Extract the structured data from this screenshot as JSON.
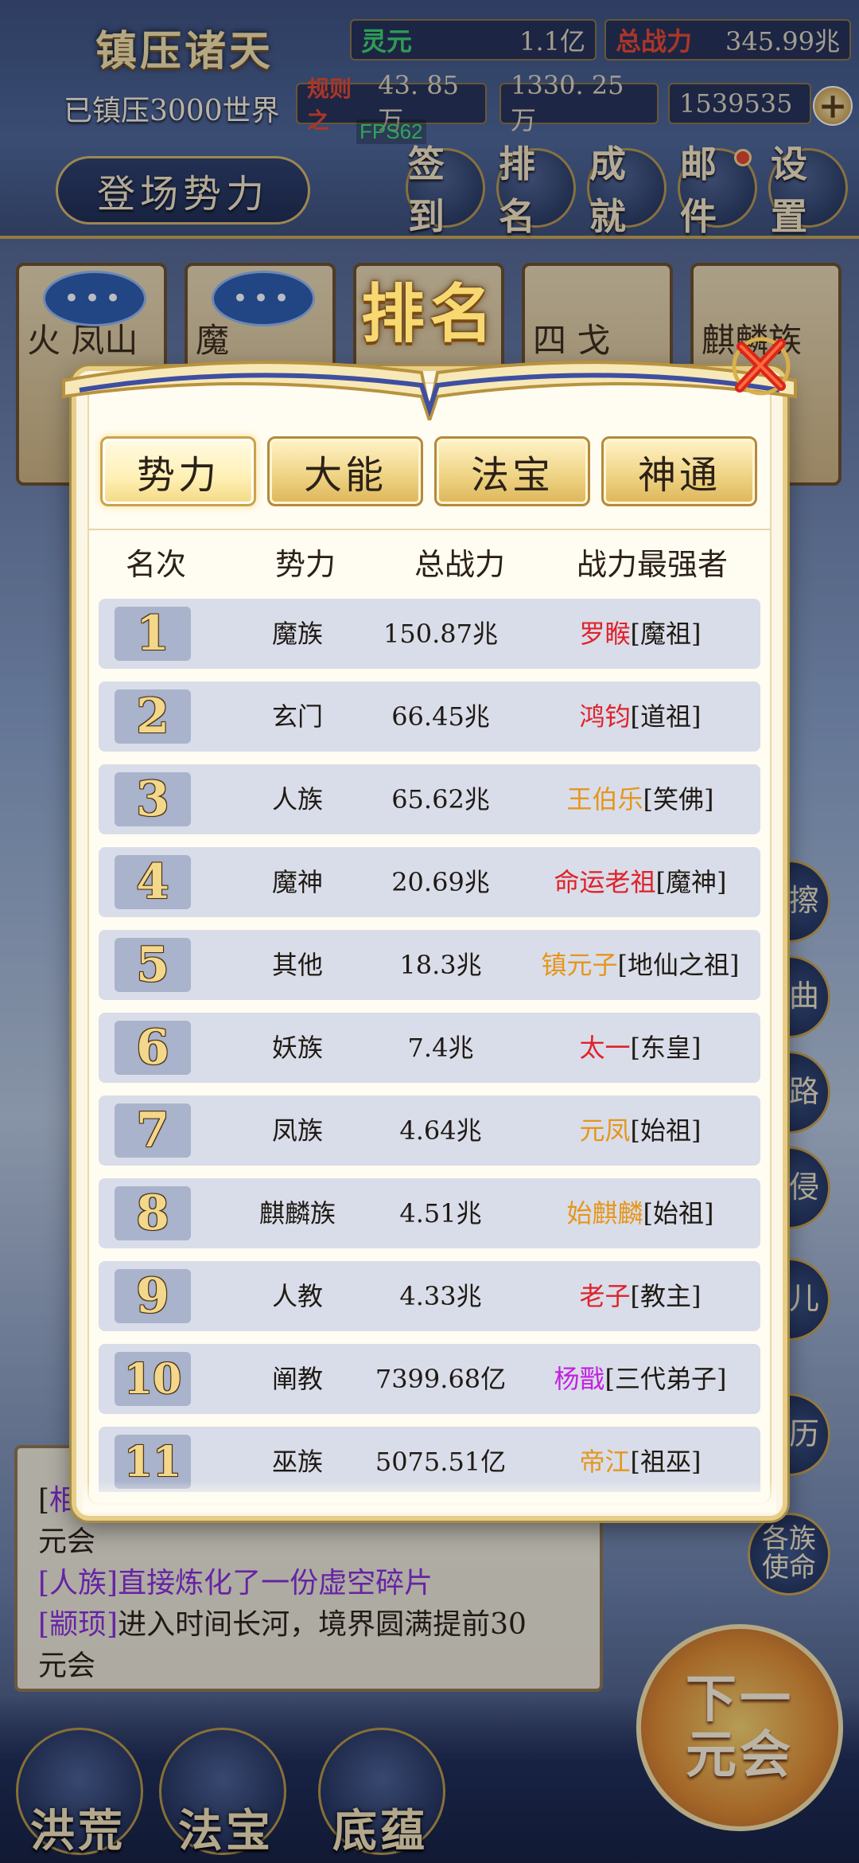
{
  "game": {
    "title": "镇压诸天",
    "subtitle": "已镇压3000世界",
    "lingyuan_label": "灵元",
    "lingyuan_value": "1.1亿",
    "total_power_label": "总战力",
    "total_power_value": "345.99兆",
    "rules_label": "规则之",
    "rules_value": "43. 85万",
    "stat_b": "1330. 25万",
    "stat_c": "1539535",
    "fps": "FPS62",
    "enter_faction": "登场势力",
    "plus": "+"
  },
  "top_buttons": [
    {
      "label": "签到",
      "dot": false
    },
    {
      "label": "排名",
      "dot": false
    },
    {
      "label": "成就",
      "dot": false
    },
    {
      "label": "邮件",
      "dot": true
    },
    {
      "label": "设置",
      "dot": false
    }
  ],
  "background_cards": [
    {
      "text": "火 凤山"
    },
    {
      "text": "魔"
    },
    {
      "text": ""
    },
    {
      "text": "四 戈"
    },
    {
      "text": "麒麟族"
    }
  ],
  "side_buttons": [
    "元擦",
    "暗曲",
    "道路",
    "域侵",
    "道儿",
    "身历",
    "各族使命"
  ],
  "log": {
    "line1_prefix": "[",
    "line1_tag": "相",
    "line1_rest": "元会",
    "line2": "[人族]直接炼化了一份虚空碎片",
    "line3_tag": "[颛顼]",
    "line3_rest": "进入时间长河，境界圆满提前30",
    "line4": "元会"
  },
  "bottom_nav": [
    "洪荒",
    "法宝",
    "底蕴"
  ],
  "next_button": {
    "line1": "下一",
    "line2": "元会"
  },
  "ranking": {
    "title": "排名",
    "tabs": [
      "势力",
      "大能",
      "法宝",
      "神通"
    ],
    "active_tab": 0,
    "headers": [
      "名次",
      "势力",
      "总战力",
      "战力最强者"
    ],
    "rows": [
      {
        "rank": "1",
        "faction": "魔族",
        "power": "150.87兆",
        "leader": "罗睺",
        "title": "[魔祖]",
        "color": "red"
      },
      {
        "rank": "2",
        "faction": "玄门",
        "power": "66.45兆",
        "leader": "鸿钧",
        "title": "[道祖]",
        "color": "red"
      },
      {
        "rank": "3",
        "faction": "人族",
        "power": "65.62兆",
        "leader": "王伯乐",
        "title": "[笑佛]",
        "color": "orange"
      },
      {
        "rank": "4",
        "faction": "魔神",
        "power": "20.69兆",
        "leader": "命运老祖",
        "title": "[魔神]",
        "color": "red"
      },
      {
        "rank": "5",
        "faction": "其他",
        "power": "18.3兆",
        "leader": "镇元子",
        "title": "[地仙之祖]",
        "color": "orange"
      },
      {
        "rank": "6",
        "faction": "妖族",
        "power": "7.4兆",
        "leader": "太一",
        "title": "[东皇]",
        "color": "red"
      },
      {
        "rank": "7",
        "faction": "凤族",
        "power": "4.64兆",
        "leader": "元凤",
        "title": "[始祖]",
        "color": "orange"
      },
      {
        "rank": "8",
        "faction": "麒麟族",
        "power": "4.51兆",
        "leader": "始麒麟",
        "title": "[始祖]",
        "color": "orange"
      },
      {
        "rank": "9",
        "faction": "人教",
        "power": "4.33兆",
        "leader": "老子",
        "title": "[教主]",
        "color": "red"
      },
      {
        "rank": "10",
        "faction": "阐教",
        "power": "7399.68亿",
        "leader": "杨戬",
        "title": "[三代弟子]",
        "color": "purple"
      },
      {
        "rank": "11",
        "faction": "巫族",
        "power": "5075.51亿",
        "leader": "帝江",
        "title": "[祖巫]",
        "color": "orange"
      }
    ]
  },
  "colors": {
    "red": "#e0222a",
    "orange": "#e6961a",
    "purple": "#c223e0",
    "gold": "#f8d870",
    "row_bg": "#d9dde9"
  }
}
